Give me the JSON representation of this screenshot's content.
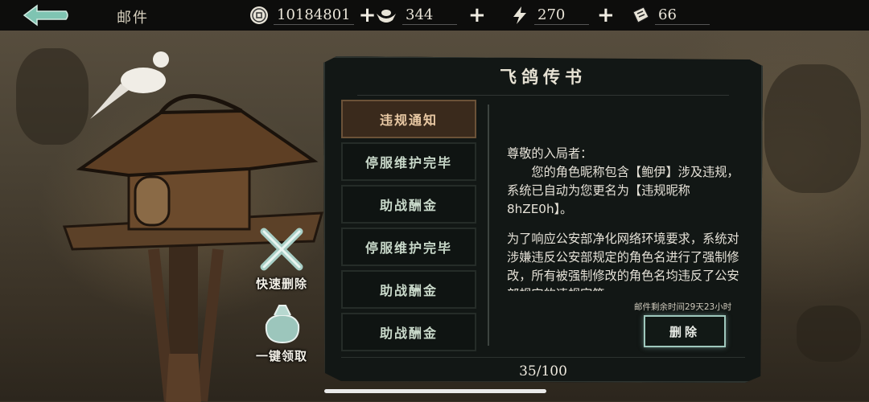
{
  "header": {
    "title": "邮件",
    "resources": [
      {
        "icon": "coin-icon",
        "value": "10184801"
      },
      {
        "icon": "silver-ingot-icon",
        "value": "344"
      },
      {
        "icon": "lightning-icon",
        "value": "270"
      },
      {
        "icon": "ticket-icon",
        "value": "66"
      }
    ]
  },
  "side_actions": {
    "quick_delete": "快速删除",
    "claim_all": "一键领取"
  },
  "panel": {
    "title": "飞鸽传书",
    "mails": [
      {
        "label": "违规通知",
        "active": true
      },
      {
        "label": "停服维护完毕",
        "active": false
      },
      {
        "label": "助战酬金",
        "active": false
      },
      {
        "label": "停服维护完毕",
        "active": false
      },
      {
        "label": "助战酬金",
        "active": false
      },
      {
        "label": "助战酬金",
        "active": false
      }
    ],
    "content": {
      "greeting": "尊敬的入局者：",
      "para1": "您的角色昵称包含【鲍伊】涉及违规，系统已自动为您更名为【违规昵称8hZE0h】。",
      "para2": "为了响应公安部净化网络环境要求，系统对涉嫌违反公安部规定的角色名进行了强制修改，所有被强制修改的角色名均违反了公安部规定的违规字符..."
    },
    "expire_text": "邮件剩余时间29天23小时",
    "delete_label": "删除",
    "counter": "35/100"
  },
  "colors": {
    "accent_active": "#3a2a1c",
    "delete_border": "#9fc8bd",
    "panel_bg": "#121715"
  }
}
